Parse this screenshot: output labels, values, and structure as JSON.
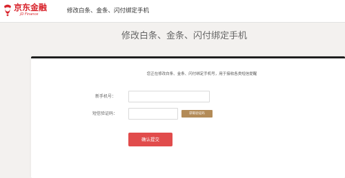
{
  "header": {
    "logo_text": "京东金融",
    "logo_sub": "JD Finance",
    "title": "修改白条、金条、闪付绑定手机"
  },
  "page": {
    "title": "修改白条、金条、闪付绑定手机"
  },
  "form": {
    "notice": "您正在修改白条、金条、闪付绑定手机号，用于接收各类短信提醒",
    "phone_label": "新手机号：",
    "phone_value": "",
    "code_label": "短信验证码：",
    "code_value": "",
    "get_code_label": "获取验证码",
    "submit_label": "确认提交"
  },
  "colors": {
    "brand": "#d8242c",
    "submit": "#e14c4c",
    "get_code": "#b38b57",
    "card_top_border": "#1d1d1d"
  }
}
